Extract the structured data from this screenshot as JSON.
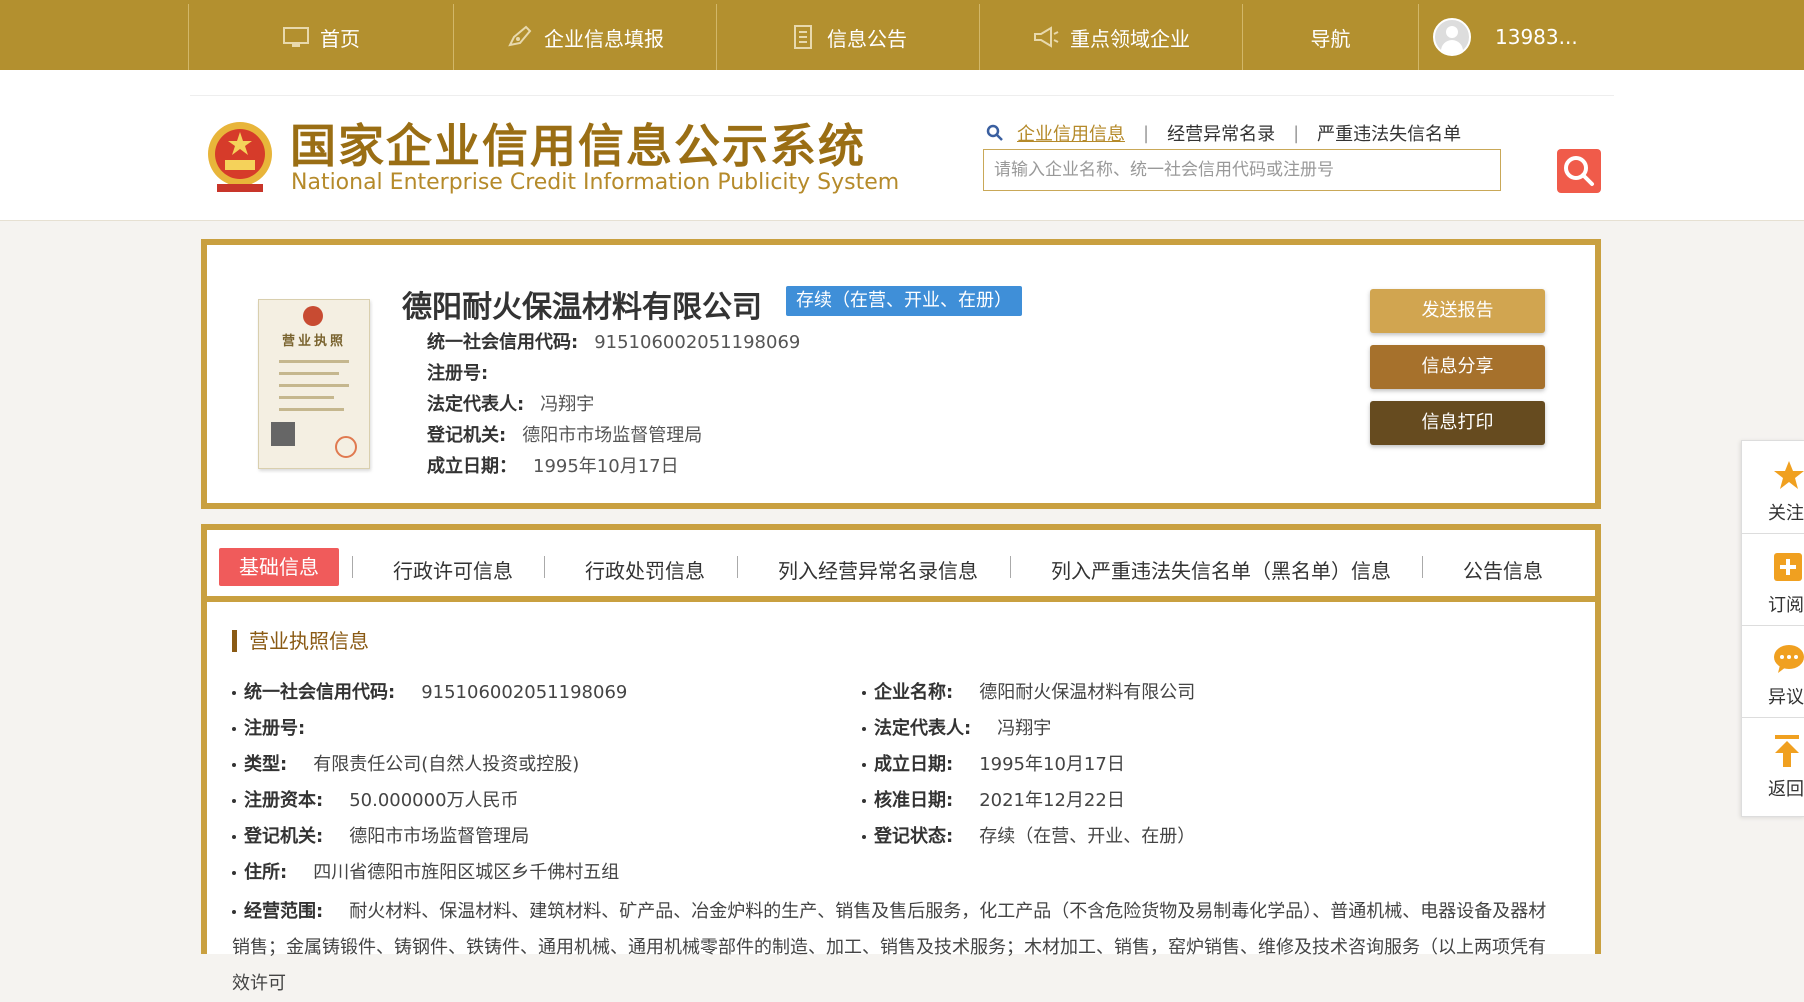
{
  "nav": {
    "items": [
      {
        "label": "首页",
        "icon": "monitor-icon"
      },
      {
        "label": "企业信息填报",
        "icon": "pen-icon"
      },
      {
        "label": "信息公告",
        "icon": "document-icon"
      },
      {
        "label": "重点领域企业",
        "icon": "megaphone-icon"
      },
      {
        "label": "导航",
        "icon": ""
      }
    ],
    "user": "13983..."
  },
  "header": {
    "title_cn": "国家企业信用信息公示系统",
    "title_en": "National Enterprise Credit Information Publicity System",
    "quicklinks": [
      "企业信用信息",
      "经营异常名录",
      "严重违法失信名单"
    ],
    "search_placeholder": "请输入企业名称、统一社会信用代码或注册号"
  },
  "company": {
    "name": "德阳耐火保温材料有限公司",
    "status": "存续（在营、开业、在册）",
    "license_title": "营业执照",
    "fields": [
      {
        "k": "统一社会信用代码:",
        "v": "915106002051198069"
      },
      {
        "k": "注册号:",
        "v": ""
      },
      {
        "k": "法定代表人:",
        "v": "冯翔宇"
      },
      {
        "k": "登记机关:",
        "v": "德阳市市场监督管理局"
      },
      {
        "k": "成立日期：",
        "v": "1995年10月17日"
      }
    ],
    "actions": [
      "发送报告",
      "信息分享",
      "信息打印"
    ]
  },
  "tabs": [
    "基础信息",
    "行政许可信息",
    "行政处罚信息",
    "列入经营异常名录信息",
    "列入严重违法失信名单（黑名单）信息",
    "公告信息"
  ],
  "details": {
    "section_title": "营业执照信息",
    "left": [
      {
        "k": "统一社会信用代码:",
        "v": "915106002051198069"
      },
      {
        "k": "注册号:",
        "v": ""
      },
      {
        "k": "类型:",
        "v": "有限责任公司(自然人投资或控股)"
      },
      {
        "k": "注册资本:",
        "v": "50.000000万人民币"
      },
      {
        "k": "登记机关:",
        "v": "德阳市市场监督管理局"
      },
      {
        "k": "住所:",
        "v": "四川省德阳市旌阳区城区乡千佛村五组"
      }
    ],
    "right": [
      {
        "k": "企业名称:",
        "v": "德阳耐火保温材料有限公司"
      },
      {
        "k": "法定代表人:",
        "v": "冯翔宇"
      },
      {
        "k": "成立日期:",
        "v": "1995年10月17日"
      },
      {
        "k": "核准日期:",
        "v": "2021年12月22日"
      },
      {
        "k": "登记状态:",
        "v": "存续（在营、开业、在册）"
      }
    ],
    "scope_label": "经营范围:",
    "scope_text": "耐火材料、保温材料、建筑材料、矿产品、冶金炉料的生产、销售及售后服务，化工产品（不含危险货物及易制毒化学品）、普通机械、电器设备及器材销售；金属铸锻件、铸钢件、铁铸件、通用机械、通用机械零部件的制造、加工、销售及技术服务；木材加工、销售，窑炉销售、维修及技术咨询服务（以上两项凭有效许可"
  },
  "float": [
    "关注",
    "订阅",
    "异议",
    "返回"
  ]
}
